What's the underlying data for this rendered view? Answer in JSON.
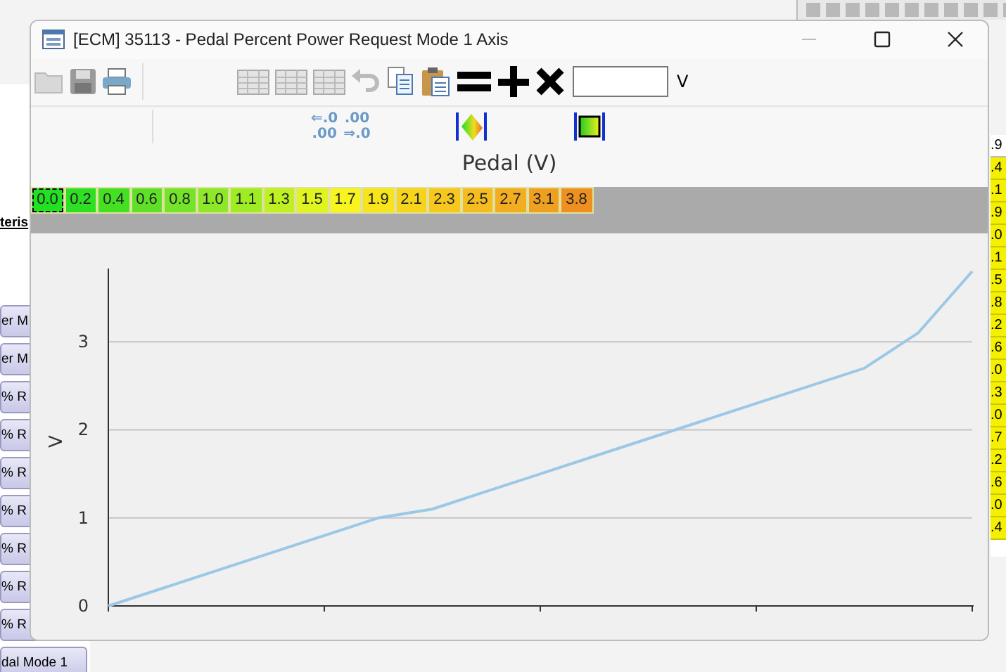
{
  "background_left": {
    "header": "teris",
    "items": [
      "er M",
      "er M",
      "% R",
      "% R",
      "% R",
      "% R",
      "% R",
      "% R",
      "% R",
      "dal Mode 1"
    ]
  },
  "background_right": {
    "top": ".9",
    "values": [
      ".4",
      ".1",
      ".9",
      ".0",
      ".1",
      ".5",
      ".8",
      ".2",
      ".6",
      ".0",
      ".3",
      ".0",
      ".7",
      ".2",
      ".6",
      ".0",
      ".4"
    ]
  },
  "window": {
    "title": "[ECM] 35113 - Pedal Percent Power Request Mode 1 Axis"
  },
  "toolbar": {
    "unit": "V"
  },
  "decimal_buttons": [
    {
      "lines": [
        "⇐.0",
        ".00"
      ]
    },
    {
      "lines": [
        ".00",
        "⇒.0"
      ]
    }
  ],
  "axis": {
    "title": "Pedal (V)",
    "cells": [
      {
        "label": "0.0",
        "color": "#22e022",
        "selected": true
      },
      {
        "label": "0.2",
        "color": "#2ee022",
        "selected": false
      },
      {
        "label": "0.4",
        "color": "#44e022",
        "selected": false
      },
      {
        "label": "0.6",
        "color": "#5ee028",
        "selected": false
      },
      {
        "label": "0.8",
        "color": "#74e428",
        "selected": false
      },
      {
        "label": "1.0",
        "color": "#8ce828",
        "selected": false
      },
      {
        "label": "1.1",
        "color": "#9eec22",
        "selected": false
      },
      {
        "label": "1.3",
        "color": "#bef022",
        "selected": false
      },
      {
        "label": "1.5",
        "color": "#e0f41e",
        "selected": false
      },
      {
        "label": "1.7",
        "color": "#f8f41e",
        "selected": false
      },
      {
        "label": "1.9",
        "color": "#f8e41a",
        "selected": false
      },
      {
        "label": "2.1",
        "color": "#f6d41c",
        "selected": false
      },
      {
        "label": "2.3",
        "color": "#f6c81e",
        "selected": false
      },
      {
        "label": "2.5",
        "color": "#f4bc1e",
        "selected": false
      },
      {
        "label": "2.7",
        "color": "#f2ae20",
        "selected": false
      },
      {
        "label": "3.1",
        "color": "#f0a020",
        "selected": false
      },
      {
        "label": "3.8",
        "color": "#ee9020",
        "selected": false
      }
    ]
  },
  "chart": {
    "chart_data": {
      "type": "line",
      "ylabel": "V",
      "ylim": [
        0,
        3.8
      ],
      "yticks": [
        0,
        1,
        2,
        3
      ],
      "grid": true,
      "series": [
        {
          "color": "#9cc8e6",
          "values": [
            0.0,
            0.2,
            0.4,
            0.6,
            0.8,
            1.0,
            1.1,
            1.3,
            1.5,
            1.7,
            1.9,
            2.1,
            2.3,
            2.5,
            2.7,
            3.1,
            3.8
          ]
        }
      ]
    }
  }
}
